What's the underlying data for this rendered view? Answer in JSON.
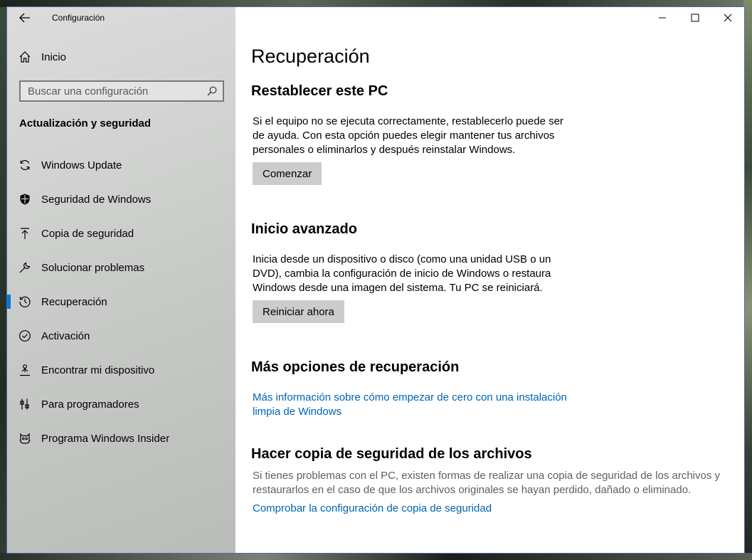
{
  "window": {
    "app_title": "Configuración"
  },
  "sidebar": {
    "home_label": "Inicio",
    "search_placeholder": "Buscar una configuración",
    "section_title": "Actualización y seguridad",
    "items": [
      {
        "label": "Windows Update",
        "icon": "sync-icon"
      },
      {
        "label": "Seguridad de Windows",
        "icon": "shield-icon"
      },
      {
        "label": "Copia de seguridad",
        "icon": "upload-arrow-icon"
      },
      {
        "label": "Solucionar problemas",
        "icon": "wrench-icon"
      },
      {
        "label": "Recuperación",
        "icon": "history-icon",
        "active": true
      },
      {
        "label": "Activación",
        "icon": "check-circle-icon"
      },
      {
        "label": "Encontrar mi dispositivo",
        "icon": "person-location-icon"
      },
      {
        "label": "Para programadores",
        "icon": "developer-tools-icon"
      },
      {
        "label": "Programa Windows Insider",
        "icon": "insider-cat-icon"
      }
    ]
  },
  "main": {
    "page_title": "Recuperación",
    "reset": {
      "heading": "Restablecer este PC",
      "description": "Si el equipo no se ejecuta correctamente, restablecerlo puede ser de ayuda. Con esta opción puedes elegir mantener tus archivos personales o eliminarlos y después reinstalar Windows.",
      "button": "Comenzar"
    },
    "advanced": {
      "heading": "Inicio avanzado",
      "description": "Inicia desde un dispositivo o disco (como una unidad USB o un DVD), cambia la configuración de inicio de Windows o restaura Windows desde una imagen del sistema. Tu PC se reiniciará.",
      "button": "Reiniciar ahora"
    },
    "more_options": {
      "heading": "Más opciones de recuperación",
      "link": "Más información sobre cómo empezar de cero con una instalación limpia de Windows"
    },
    "backup": {
      "heading": "Hacer copia de seguridad de los archivos",
      "description": "Si tienes problemas con el PC, existen formas de realizar una copia de seguridad de los archivos y restaurarlos en el caso de que los archivos originales se hayan perdido, dañado o eliminado.",
      "link": "Comprobar la configuración de copia de seguridad"
    }
  },
  "colors": {
    "accent": "#0078d7",
    "link": "#0063b1",
    "button_bg": "#cccccc"
  }
}
